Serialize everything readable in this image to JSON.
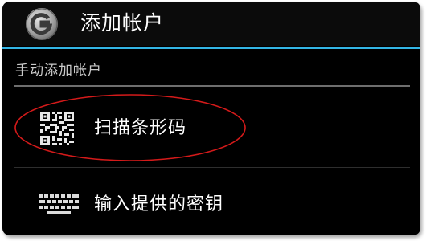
{
  "action_bar": {
    "title": "添加帐户",
    "app_icon": "google-authenticator-g-icon"
  },
  "section": {
    "header": "手动添加帐户"
  },
  "options": [
    {
      "label": "扫描条形码",
      "icon": "qr-code-icon",
      "highlighted": true
    },
    {
      "label": "输入提供的密钥",
      "icon": "keyboard-icon",
      "highlighted": false
    }
  ],
  "colors": {
    "background": "#000000",
    "accent": "#33b5e5",
    "text": "#ffffff",
    "section_text": "#c9c9c9",
    "highlight_circle": "#d41a1a"
  }
}
